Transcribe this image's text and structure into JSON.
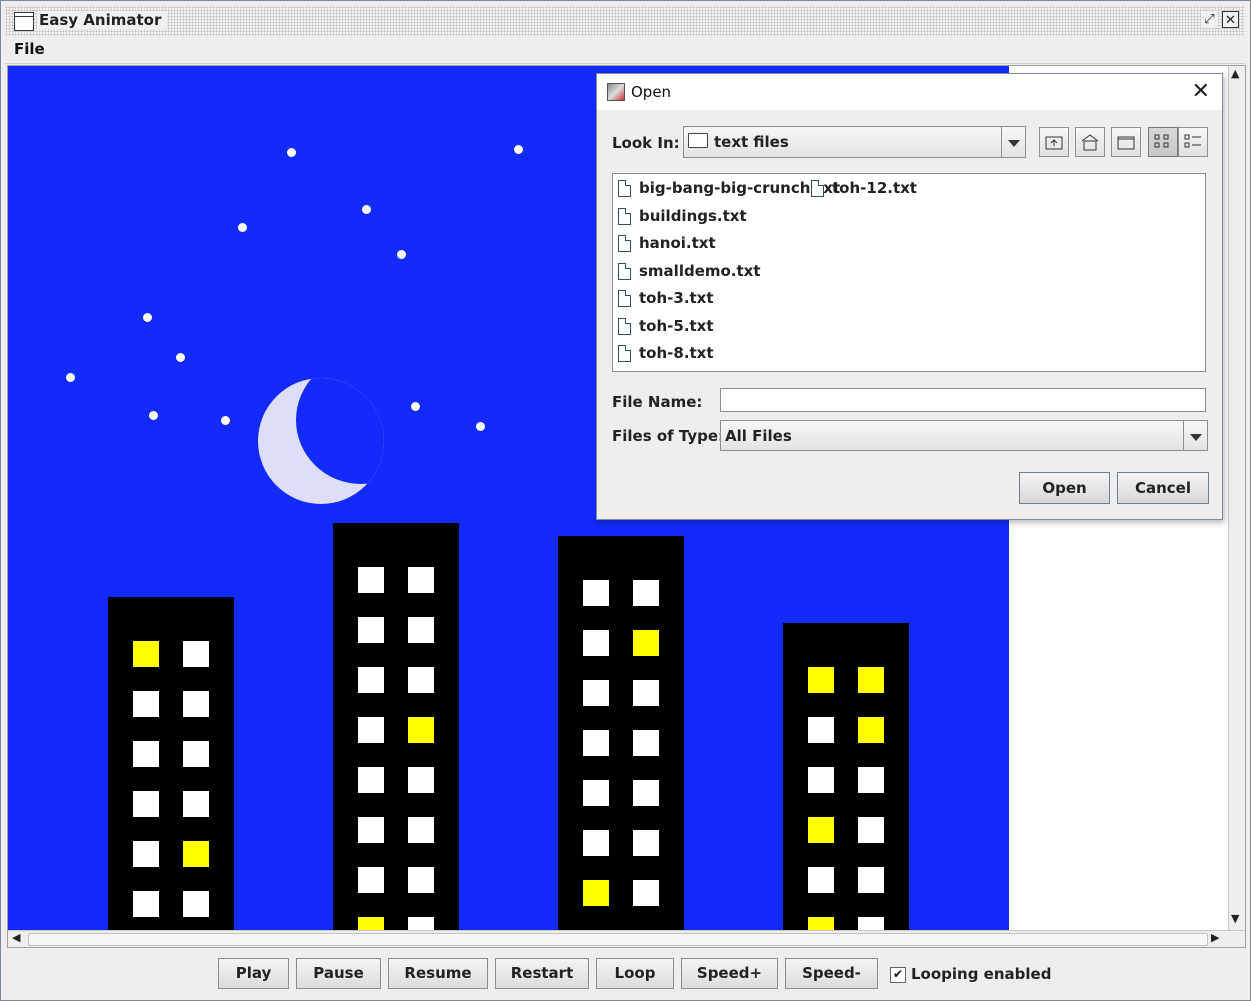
{
  "window": {
    "title": "Easy Animator",
    "restore_glyph": "⤢",
    "close_glyph": "✕"
  },
  "menu": {
    "file": "File"
  },
  "colors": {
    "sky": "#132bfa",
    "building": "#000000",
    "window_off": "#ffffff",
    "window_on": "#ffff00",
    "moon": "#dedef8"
  },
  "controls": {
    "buttons": [
      "Play",
      "Pause",
      "Resume",
      "Restart",
      "Loop",
      "Speed+",
      "Speed-"
    ],
    "looping_checked": true,
    "looping_label": "Looping enabled"
  },
  "dialog": {
    "title": "Open",
    "look_in_label": "Look In:",
    "look_in_value": "text files",
    "files": [
      "big-bang-big-crunch.txt",
      "buildings.txt",
      "hanoi.txt",
      "smalldemo.txt",
      "toh-3.txt",
      "toh-5.txt",
      "toh-8.txt",
      "toh-12.txt"
    ],
    "file_name_label": "File Name:",
    "file_name_value": "",
    "files_of_type_label": "Files of Type:",
    "files_of_type_value": "All Files",
    "open_button": "Open",
    "cancel_button": "Cancel",
    "toolbar_icons": [
      "up-one-level-icon",
      "home-icon",
      "new-folder-icon",
      "list-view-icon",
      "details-view-icon"
    ]
  },
  "scene": {
    "buildings": [
      {
        "windows": [
          [
            "on",
            "off"
          ],
          [
            "off",
            "off"
          ],
          [
            "off",
            "off"
          ],
          [
            "off",
            "off"
          ],
          [
            "off",
            "on"
          ],
          [
            "off",
            "off"
          ]
        ]
      },
      {
        "windows": [
          [
            "off",
            "off"
          ],
          [
            "off",
            "off"
          ],
          [
            "off",
            "off"
          ],
          [
            "off",
            "on"
          ],
          [
            "off",
            "off"
          ],
          [
            "off",
            "off"
          ],
          [
            "off",
            "off"
          ],
          [
            "on",
            "off"
          ]
        ]
      },
      {
        "windows": [
          [
            "off",
            "off"
          ],
          [
            "off",
            "on"
          ],
          [
            "off",
            "off"
          ],
          [
            "off",
            "off"
          ],
          [
            "off",
            "off"
          ],
          [
            "off",
            "off"
          ],
          [
            "on",
            "off"
          ]
        ]
      },
      {
        "windows": [
          [
            "on",
            "on"
          ],
          [
            "off",
            "on"
          ],
          [
            "off",
            "off"
          ],
          [
            "on",
            "off"
          ],
          [
            "off",
            "off"
          ],
          [
            "on",
            "off"
          ]
        ]
      }
    ]
  }
}
